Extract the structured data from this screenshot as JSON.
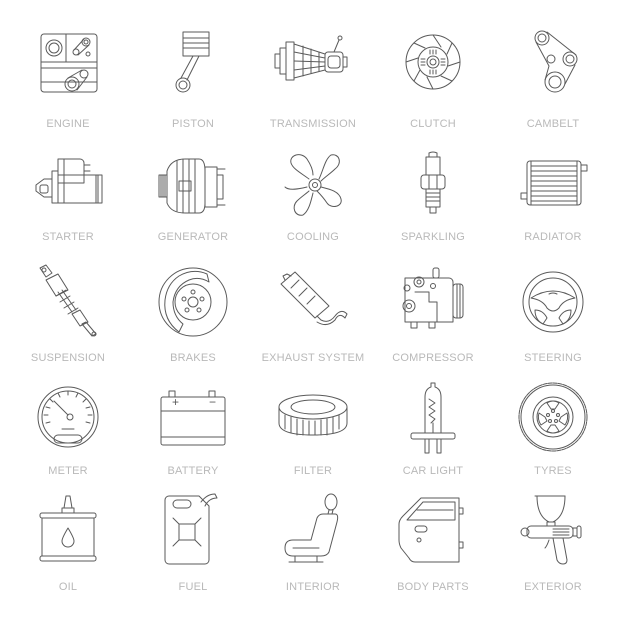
{
  "colors": {
    "background": "#ffffff",
    "icon_stroke": "#5a5a5a",
    "label": "#b9b9b9"
  },
  "items": [
    {
      "label": "ENGINE",
      "icon": "engine-icon"
    },
    {
      "label": "PISTON",
      "icon": "piston-icon"
    },
    {
      "label": "TRANSMISSION",
      "icon": "transmission-icon"
    },
    {
      "label": "CLUTCH",
      "icon": "clutch-icon"
    },
    {
      "label": "CAMBELT",
      "icon": "cambelt-icon"
    },
    {
      "label": "STARTER",
      "icon": "starter-icon"
    },
    {
      "label": "GENERATOR",
      "icon": "generator-icon"
    },
    {
      "label": "COOLING",
      "icon": "cooling-fan-icon"
    },
    {
      "label": "SPARKLING",
      "icon": "spark-plug-icon"
    },
    {
      "label": "RADIATOR",
      "icon": "radiator-icon"
    },
    {
      "label": "SUSPENSION",
      "icon": "suspension-icon"
    },
    {
      "label": "BRAKES",
      "icon": "brake-disc-icon"
    },
    {
      "label": "EXHAUST SYSTEM",
      "icon": "exhaust-icon"
    },
    {
      "label": "COMPRESSOR",
      "icon": "compressor-icon"
    },
    {
      "label": "STEERING",
      "icon": "steering-wheel-icon"
    },
    {
      "label": "METER",
      "icon": "speedometer-icon"
    },
    {
      "label": "BATTERY",
      "icon": "battery-icon"
    },
    {
      "label": "FILTER",
      "icon": "air-filter-icon"
    },
    {
      "label": "CAR LIGHT",
      "icon": "headlight-bulb-icon"
    },
    {
      "label": "TYRES",
      "icon": "tyre-icon"
    },
    {
      "label": "OIL",
      "icon": "oil-can-icon"
    },
    {
      "label": "FUEL",
      "icon": "fuel-canister-icon"
    },
    {
      "label": "INTERIOR",
      "icon": "car-seat-icon"
    },
    {
      "label": "BODY PARTS",
      "icon": "car-door-icon"
    },
    {
      "label": "EXTERIOR",
      "icon": "spray-gun-icon"
    }
  ],
  "battery": {
    "plus": "+",
    "minus": "−"
  }
}
